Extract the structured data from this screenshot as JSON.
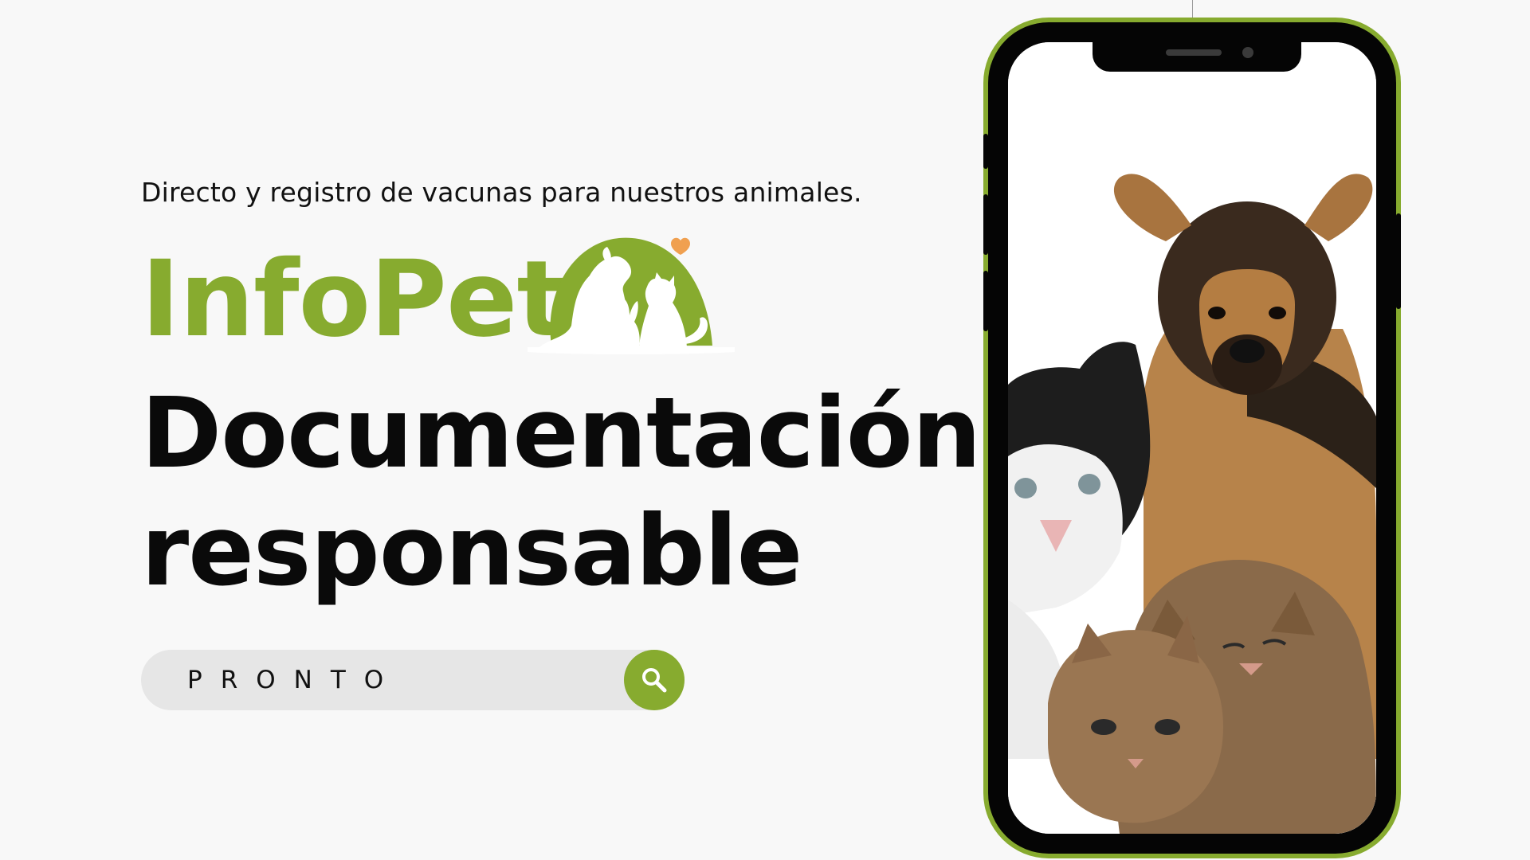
{
  "tagline": "Directo y registro de vacunas para nuestros animales.",
  "brand": {
    "name": "InfoPet",
    "logo_icon": "pets-silhouette-logo",
    "heart_icon": "heart-icon"
  },
  "headline": {
    "line1": "Documentación",
    "line2": "responsable"
  },
  "search": {
    "text": "PRONTO",
    "icon": "search-icon"
  },
  "phone": {
    "screen_image": "puppy-and-kittens-photo"
  },
  "colors": {
    "background": "#f8f8f8",
    "brand_green": "#87ab2f",
    "text": "#0a0a0a",
    "heart": "#f0a050",
    "search_bar": "#e6e6e6"
  }
}
